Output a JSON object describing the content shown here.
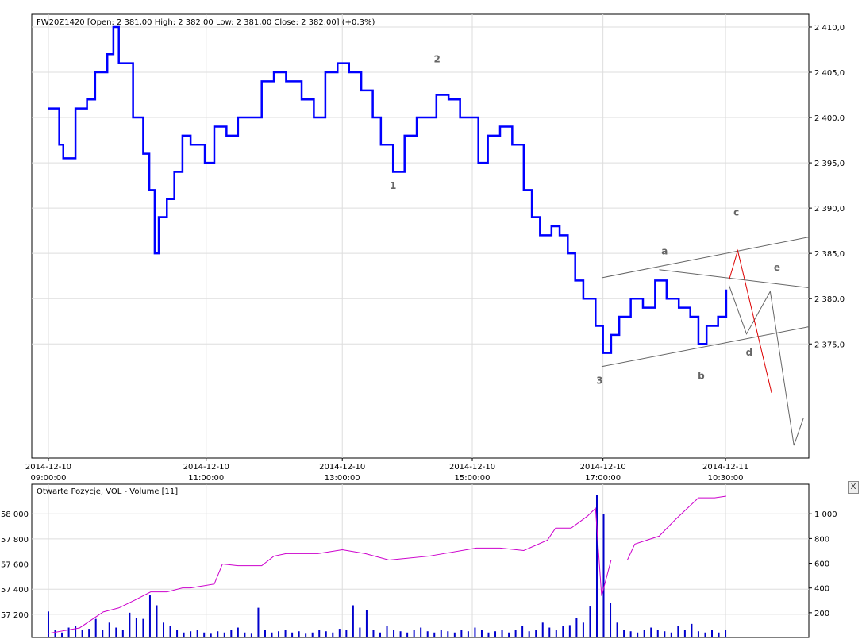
{
  "chart_data": [
    {
      "type": "line",
      "title": "FW20Z1420 [Open: 2 381,00  High: 2 382,00  Low: 2 381,00  Close: 2 382,00] (+0,3%)",
      "instrument": "FW20Z1420",
      "xlim": [
        -2.46,
        112.3
      ],
      "ylim": [
        2362.4,
        2411.4
      ],
      "grid": true,
      "x_ticks": [
        {
          "t": 0,
          "date": "2014-12-10",
          "time": "09:00:00"
        },
        {
          "t": 23.3,
          "date": "2014-12-10",
          "time": "11:00:00"
        },
        {
          "t": 43.4,
          "date": "2014-12-10",
          "time": "13:00:00"
        },
        {
          "t": 62.6,
          "date": "2014-12-10",
          "time": "15:00:00"
        },
        {
          "t": 81.9,
          "date": "2014-12-10",
          "time": "17:00:00"
        },
        {
          "t": 100,
          "date": "2014-12-11",
          "time": "10:30:00"
        }
      ],
      "y_ticks": [
        {
          "v": 2410,
          "label": "2 410,0"
        },
        {
          "v": 2405,
          "label": "2 405,0"
        },
        {
          "v": 2400,
          "label": "2 400,0"
        },
        {
          "v": 2395,
          "label": "2 395,0"
        },
        {
          "v": 2390,
          "label": "2 390,0"
        },
        {
          "v": 2385,
          "label": "2 385,0"
        },
        {
          "v": 2380,
          "label": "2 380,0"
        },
        {
          "v": 2375,
          "label": "2 375,0"
        }
      ],
      "series": [
        {
          "name": "FW20Z1420",
          "color": "#0000ff",
          "t": [
            0,
            1.6,
            2.2,
            4.0,
            5.7,
            6.9,
            8.7,
            9.6,
            10.4,
            11.6,
            12.5,
            14.0,
            14.9,
            15.7,
            16.3,
            17.5,
            18.6,
            19.8,
            21.0,
            23.1,
            24.5,
            26.3,
            28.0,
            30.4,
            31.5,
            33.3,
            35.1,
            37.4,
            39.2,
            40.9,
            42.7,
            44.4,
            46.2,
            47.9,
            49.1,
            50.9,
            52.6,
            54.4,
            56.2,
            57.3,
            59.1,
            60.8,
            62.6,
            63.5,
            64.9,
            66.7,
            68.5,
            70.2,
            71.4,
            72.6,
            74.3,
            75.5,
            76.7,
            77.8,
            79.0,
            80.8,
            81.9,
            83.1,
            84.3,
            86.0,
            87.8,
            89.6,
            91.3,
            93.1,
            94.8,
            96.0,
            97.2,
            98.9,
            100.1
          ],
          "values": [
            2401,
            2397,
            2395.5,
            2401,
            2402,
            2405,
            2407,
            2410,
            2406,
            2406,
            2400,
            2396,
            2392,
            2385,
            2389,
            2391,
            2394,
            2398,
            2397,
            2395,
            2399,
            2398,
            2400,
            2400,
            2404,
            2405,
            2404,
            2402,
            2400,
            2405,
            2406,
            2405,
            2403,
            2400,
            2397,
            2394,
            2398,
            2400,
            2400,
            2402.5,
            2402,
            2400,
            2400,
            2395,
            2398,
            2399,
            2397,
            2392,
            2389,
            2387,
            2388,
            2387,
            2385,
            2382,
            2380,
            2377,
            2374,
            2376,
            2378,
            2380,
            2379,
            2382,
            2380,
            2379,
            2378,
            2375,
            2377,
            2378,
            2381
          ]
        }
      ],
      "annotations": {
        "wave_labels": [
          {
            "text": "1",
            "t": 50.9,
            "v": 2392.1
          },
          {
            "text": "2",
            "t": 57.4,
            "v": 2406.1
          },
          {
            "text": "3",
            "t": 81.4,
            "v": 2370.6
          },
          {
            "text": "a",
            "t": 91.0,
            "v": 2384.9
          },
          {
            "text": "b",
            "t": 96.4,
            "v": 2371.1
          },
          {
            "text": "c",
            "t": 101.6,
            "v": 2389.2
          },
          {
            "text": "d",
            "t": 103.5,
            "v": 2373.7
          },
          {
            "text": "e",
            "t": 107.6,
            "v": 2383.1
          }
        ],
        "trendlines": [
          {
            "color": "#666666",
            "points": [
              [
                81.7,
                2382.3
              ],
              [
                112.3,
                2386.8
              ]
            ]
          },
          {
            "color": "#666666",
            "points": [
              [
                81.7,
                2372.5
              ],
              [
                112.3,
                2376.9
              ]
            ]
          },
          {
            "color": "#666666",
            "points": [
              [
                90.2,
                2383.2
              ],
              [
                112.3,
                2381.2
              ]
            ]
          },
          {
            "color": "#666666",
            "points": [
              [
                100.5,
                2381.5
              ],
              [
                103.1,
                2376.1
              ],
              [
                106.6,
                2380.8
              ],
              [
                110.1,
                2363.8
              ],
              [
                111.5,
                2366.8
              ]
            ]
          },
          {
            "color": "#dd0000",
            "points": [
              [
                100.5,
                2382.0
              ],
              [
                101.8,
                2385.3
              ],
              [
                106.8,
                2369.6
              ]
            ]
          }
        ]
      }
    },
    {
      "type": "line",
      "title": "Otwarte Pozycje, VOL - Volume [11]",
      "xlim": [
        -2.46,
        112.3
      ],
      "ylim_left": [
        57016,
        58235
      ],
      "ylim_right": [
        0,
        1239
      ],
      "left_ticks": [
        {
          "v": 58000,
          "label": "58 000"
        },
        {
          "v": 57800,
          "label": "57 800"
        },
        {
          "v": 57600,
          "label": "57 600"
        },
        {
          "v": 57400,
          "label": "57 400"
        },
        {
          "v": 57200,
          "label": "57 200"
        }
      ],
      "right_ticks": [
        {
          "v": 1000,
          "label": "1 000"
        },
        {
          "v": 800,
          "label": "800"
        },
        {
          "v": 600,
          "label": "600"
        },
        {
          "v": 400,
          "label": "400"
        },
        {
          "v": 200,
          "label": "200"
        }
      ],
      "open_interest": {
        "name": "Otwarte Pozycje",
        "color": "#cc00cc",
        "t": [
          0,
          4.6,
          8.1,
          10.4,
          12.8,
          15.1,
          17.5,
          19.8,
          21.0,
          24.5,
          25.7,
          28.0,
          31.5,
          33.3,
          35.1,
          39.8,
          43.4,
          46.8,
          50.3,
          56.2,
          63.2,
          66.7,
          70.2,
          73.7,
          74.9,
          77.2,
          79.6,
          80.8,
          81.7,
          83.1,
          85.5,
          86.6,
          90.2,
          92.5,
          96.0,
          98.4,
          100.1
        ],
        "values": [
          57048,
          57092,
          57219,
          57251,
          57314,
          57378,
          57378,
          57410,
          57410,
          57441,
          57600,
          57587,
          57587,
          57663,
          57683,
          57683,
          57714,
          57683,
          57632,
          57663,
          57727,
          57727,
          57708,
          57790,
          57886,
          57886,
          57981,
          58044,
          57346,
          57632,
          57632,
          57759,
          57822,
          57949,
          58127,
          58127,
          58140
        ]
      },
      "volume": {
        "name": "VOL",
        "color": "#0000cc",
        "values": [
          210,
          60,
          40,
          80,
          90,
          60,
          70,
          150,
          60,
          120,
          80,
          60,
          200,
          160,
          150,
          340,
          260,
          120,
          90,
          60,
          40,
          50,
          60,
          40,
          30,
          50,
          40,
          60,
          80,
          40,
          30,
          240,
          60,
          40,
          50,
          60,
          40,
          50,
          30,
          40,
          60,
          50,
          40,
          70,
          60,
          260,
          80,
          220,
          60,
          40,
          90,
          60,
          50,
          40,
          60,
          80,
          50,
          40,
          60,
          50,
          40,
          60,
          50,
          80,
          60,
          40,
          50,
          60,
          40,
          60,
          90,
          50,
          60,
          120,
          80,
          60,
          90,
          100,
          160,
          120,
          250,
          1150,
          1000,
          280,
          120,
          60,
          50,
          40,
          60,
          80,
          60,
          50,
          40,
          90,
          60,
          110,
          50,
          40,
          60,
          40,
          60
        ]
      }
    }
  ],
  "ui": {
    "close_label": "X"
  }
}
